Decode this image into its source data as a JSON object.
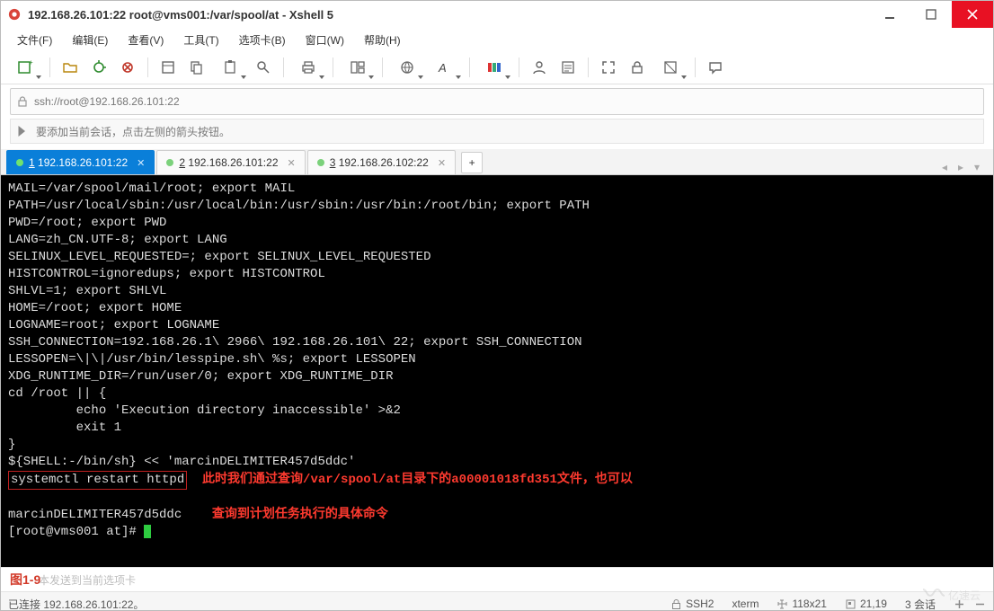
{
  "titlebar": {
    "title": "192.168.26.101:22   root@vms001:/var/spool/at - Xshell 5"
  },
  "menu": [
    "文件(F)",
    "编辑(E)",
    "查看(V)",
    "工具(T)",
    "选项卡(B)",
    "窗口(W)",
    "帮助(H)"
  ],
  "address": "ssh://root@192.168.26.101:22",
  "hint": "要添加当前会话，点击左侧的箭头按钮。",
  "tabs": [
    {
      "hotkey": "1",
      "label": "192.168.26.101:22"
    },
    {
      "hotkey": "2",
      "label": "192.168.26.101:22"
    },
    {
      "hotkey": "3",
      "label": "192.168.26.102:22"
    }
  ],
  "terminal": {
    "l0": "MAIL=/var/spool/mail/root; export MAIL",
    "l1": "PATH=/usr/local/sbin:/usr/local/bin:/usr/sbin:/usr/bin:/root/bin; export PATH",
    "l2": "PWD=/root; export PWD",
    "l3": "LANG=zh_CN.UTF-8; export LANG",
    "l4": "SELINUX_LEVEL_REQUESTED=; export SELINUX_LEVEL_REQUESTED",
    "l5": "HISTCONTROL=ignoredups; export HISTCONTROL",
    "l6": "SHLVL=1; export SHLVL",
    "l7": "HOME=/root; export HOME",
    "l8": "LOGNAME=root; export LOGNAME",
    "l9": "SSH_CONNECTION=192.168.26.1\\ 2966\\ 192.168.26.101\\ 22; export SSH_CONNECTION",
    "l10": "LESSOPEN=\\|\\|/usr/bin/lesspipe.sh\\ %s; export LESSOPEN",
    "l11": "XDG_RUNTIME_DIR=/run/user/0; export XDG_RUNTIME_DIR",
    "l12": "cd /root || {",
    "l13": "         echo 'Execution directory inaccessible' >&2",
    "l14": "         exit 1",
    "l15": "}",
    "l16": "${SHELL:-/bin/sh} << 'marcinDELIMITER457d5ddc'",
    "boxed": "systemctl restart httpd",
    "anno1": "此时我们通过查询/var/spool/at目录下的a00001018fd351文件，也可以",
    "l18": "marcinDELIMITER457d5ddc",
    "anno2": "查询到计划任务执行的具体命令",
    "prompt": "[root@vms001 at]#"
  },
  "figure_label": "图1-9",
  "sendbar_placeholder": "本发送到当前选项卡",
  "status": {
    "connection": "已连接 192.168.26.101:22。",
    "protocol": "SSH2",
    "termtype": "xterm",
    "size": "118x21",
    "cursor": "21,19",
    "sessions": "3 会话"
  }
}
